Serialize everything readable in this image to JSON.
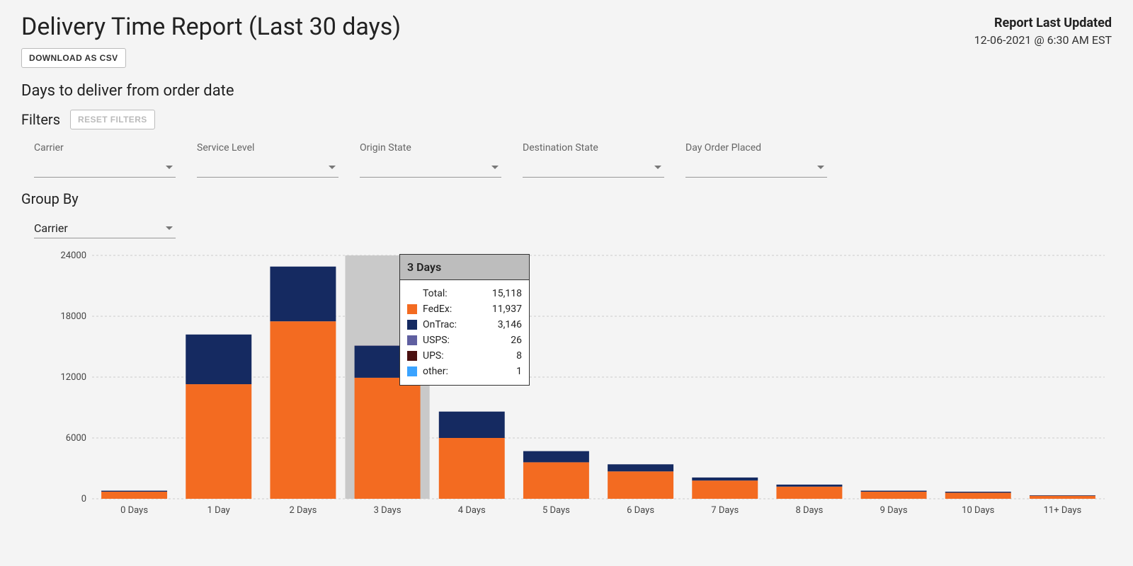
{
  "header": {
    "title": "Delivery Time Report (Last 30 days)",
    "updated_label": "Report Last Updated",
    "updated_time": "12-06-2021 @ 6:30 AM EST",
    "download_label": "Download as CSV"
  },
  "subtitle": "Days to deliver from order date",
  "filters": {
    "section_label": "Filters",
    "reset_label": "Reset Filters",
    "items": [
      {
        "label": "Carrier",
        "value": ""
      },
      {
        "label": "Service Level",
        "value": ""
      },
      {
        "label": "Origin State",
        "value": ""
      },
      {
        "label": "Destination State",
        "value": ""
      },
      {
        "label": "Day Order Placed",
        "value": ""
      }
    ]
  },
  "group_by": {
    "label": "Group By",
    "value": "Carrier"
  },
  "tooltip": {
    "title": "3 Days",
    "total_label": "Total:",
    "total_value": "15,118",
    "rows": [
      {
        "label": "FedEx:",
        "value": "11,937",
        "color": "#f36b21"
      },
      {
        "label": "OnTrac:",
        "value": "3,146",
        "color": "#152a61"
      },
      {
        "label": "USPS:",
        "value": "26",
        "color": "#5f5fa0"
      },
      {
        "label": "UPS:",
        "value": "8",
        "color": "#4a1010"
      },
      {
        "label": "other:",
        "value": "1",
        "color": "#3aa3ff"
      }
    ]
  },
  "chart_data": {
    "type": "bar",
    "stacked": true,
    "title": "",
    "xlabel": "",
    "ylabel": "",
    "ylim": [
      0,
      24000
    ],
    "yticks": [
      0,
      6000,
      12000,
      18000,
      24000
    ],
    "categories": [
      "0 Days",
      "1 Day",
      "2 Days",
      "3 Days",
      "4 Days",
      "5 Days",
      "6 Days",
      "7 Days",
      "8 Days",
      "9 Days",
      "10 Days",
      "11+ Days"
    ],
    "series": [
      {
        "name": "FedEx",
        "color": "#f36b21",
        "values": [
          700,
          11300,
          17500,
          11937,
          6000,
          3600,
          2700,
          1800,
          1200,
          700,
          600,
          300
        ]
      },
      {
        "name": "OnTrac",
        "color": "#152a61",
        "values": [
          100,
          4900,
          5400,
          3146,
          2600,
          1100,
          700,
          300,
          200,
          100,
          100,
          50
        ]
      },
      {
        "name": "USPS",
        "color": "#5f5fa0",
        "values": [
          0,
          0,
          0,
          26,
          0,
          0,
          0,
          0,
          0,
          0,
          0,
          0
        ]
      },
      {
        "name": "UPS",
        "color": "#4a1010",
        "values": [
          0,
          0,
          0,
          8,
          0,
          0,
          0,
          0,
          0,
          0,
          0,
          0
        ]
      },
      {
        "name": "other",
        "color": "#3aa3ff",
        "values": [
          0,
          0,
          0,
          1,
          0,
          0,
          0,
          0,
          0,
          0,
          0,
          0
        ]
      }
    ],
    "highlight_index": 3
  }
}
